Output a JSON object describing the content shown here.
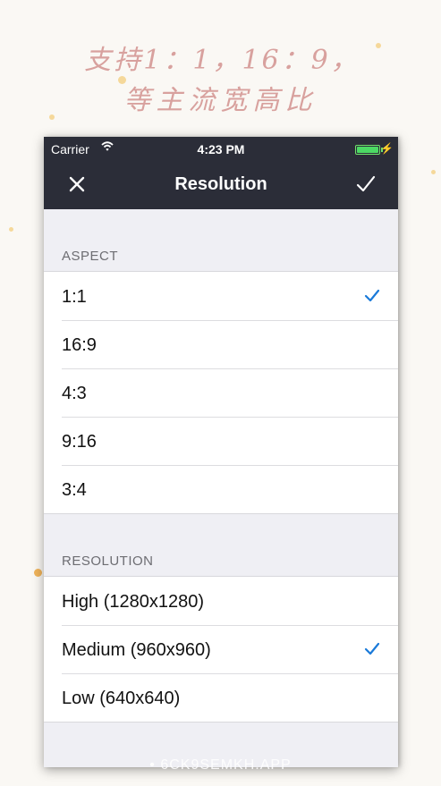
{
  "promo": {
    "line1": "支持1：1，16：9，",
    "line2": "等主流宽高比"
  },
  "status_bar": {
    "carrier": "Carrier",
    "time": "4:23 PM",
    "wifi_icon": "wifi-icon",
    "battery_level": 1.0
  },
  "nav": {
    "title": "Resolution",
    "close_icon": "close-icon",
    "done_icon": "checkmark-icon"
  },
  "aspect": {
    "header": "ASPECT",
    "items": [
      {
        "label": "1:1",
        "selected": true
      },
      {
        "label": "16:9",
        "selected": false
      },
      {
        "label": "4:3",
        "selected": false
      },
      {
        "label": "9:16",
        "selected": false
      },
      {
        "label": "3:4",
        "selected": false
      }
    ]
  },
  "resolution": {
    "header": "RESOLUTION",
    "items": [
      {
        "label": "High (1280x1280)",
        "selected": false
      },
      {
        "label": "Medium (960x960)",
        "selected": true
      },
      {
        "label": "Low (640x640)",
        "selected": false
      }
    ]
  },
  "watermark": "• 6CK9SEMKH.APP",
  "colors": {
    "nav_bg": "#2b2d38",
    "checkmark": "#1a7ad9",
    "battery": "#4cd964",
    "promo_text": "#d8a19e"
  }
}
